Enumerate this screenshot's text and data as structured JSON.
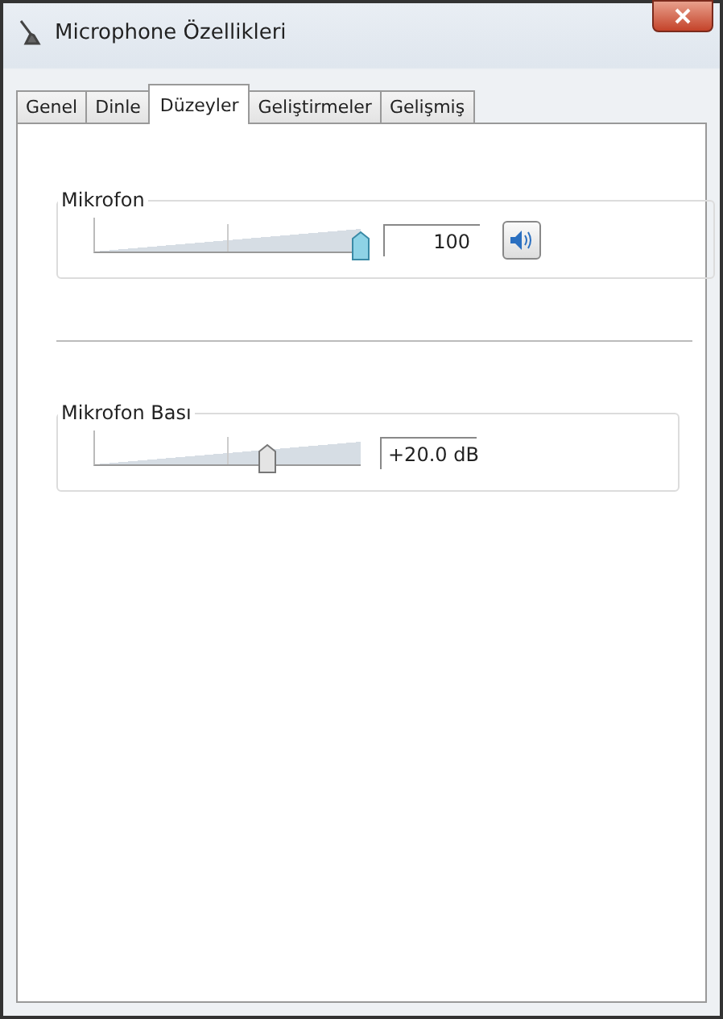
{
  "window": {
    "title": "Microphone Özellikleri"
  },
  "tabs": [
    {
      "label": "Genel",
      "selected": false
    },
    {
      "label": "Dinle",
      "selected": false
    },
    {
      "label": "Düzeyler",
      "selected": true
    },
    {
      "label": "Geliştirmeler",
      "selected": false
    },
    {
      "label": "Gelişmiş",
      "selected": false
    }
  ],
  "levels": [
    {
      "kind": "volume",
      "label": "Mikrofon",
      "level": 1.0,
      "value": "100",
      "muted": false
    },
    {
      "kind": "boost",
      "label": "Mikrofon Bası",
      "level": 0.65,
      "value": "+20.0 dB"
    }
  ]
}
